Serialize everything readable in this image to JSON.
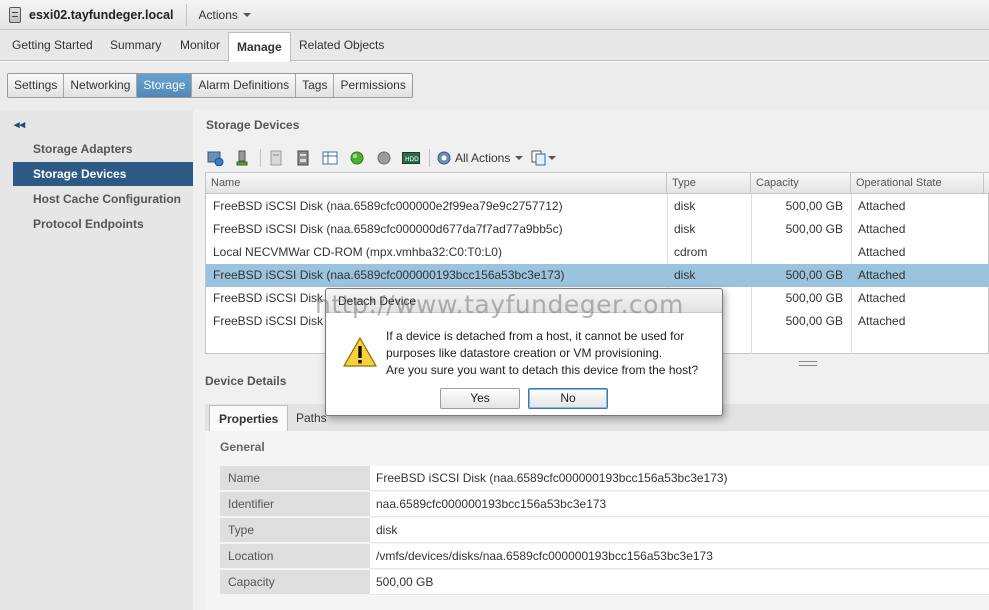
{
  "titlebar": {
    "host": "esxi02.tayfundeger.local",
    "actions_label": "Actions"
  },
  "main_tabs": [
    "Getting Started",
    "Summary",
    "Monitor",
    "Manage",
    "Related Objects"
  ],
  "sub_tabs": [
    "Settings",
    "Networking",
    "Storage",
    "Alarm Definitions",
    "Tags",
    "Permissions"
  ],
  "left_nav": [
    "Storage Adapters",
    "Storage Devices",
    "Host Cache Configuration",
    "Protocol Endpoints"
  ],
  "storage_devices": {
    "title": "Storage Devices",
    "all_actions_label": "All Actions",
    "columns": [
      "Name",
      "Type",
      "Capacity",
      "Operational State"
    ],
    "rows": [
      {
        "name": "FreeBSD iSCSI Disk (naa.6589cfc000000e2f99ea79e9c2757712)",
        "type": "disk",
        "capacity": "500,00 GB",
        "state": "Attached"
      },
      {
        "name": "FreeBSD iSCSI Disk (naa.6589cfc000000d677da7f7ad77a9bb5c)",
        "type": "disk",
        "capacity": "500,00 GB",
        "state": "Attached"
      },
      {
        "name": "Local NECVMWar CD-ROM (mpx.vmhba32:C0:T0:L0)",
        "type": "cdrom",
        "capacity": "",
        "state": "Attached"
      },
      {
        "name": "FreeBSD iSCSI Disk (naa.6589cfc000000193bcc156a53bc3e173)",
        "type": "disk",
        "capacity": "500,00 GB",
        "state": "Attached"
      },
      {
        "name": "FreeBSD iSCSI Disk",
        "type": "",
        "capacity": "500,00 GB",
        "state": "Attached"
      },
      {
        "name": "FreeBSD iSCSI Disk",
        "type": "",
        "capacity": "500,00 GB",
        "state": "Attached"
      }
    ]
  },
  "device_details": {
    "title": "Device Details",
    "tabs": [
      "Properties",
      "Paths"
    ],
    "section": "General",
    "properties": [
      {
        "key": "Name",
        "value": "FreeBSD iSCSI Disk (naa.6589cfc000000193bcc156a53bc3e173)"
      },
      {
        "key": "Identifier",
        "value": "naa.6589cfc000000193bcc156a53bc3e173"
      },
      {
        "key": "Type",
        "value": "disk"
      },
      {
        "key": "Location",
        "value": "/vmfs/devices/disks/naa.6589cfc000000193bcc156a53bc3e173"
      },
      {
        "key": "Capacity",
        "value": "500,00 GB"
      }
    ]
  },
  "dialog": {
    "title": "Detach Device",
    "line1": "If a device is detached from a host, it cannot be used for",
    "line2": "purposes like datastore creation or VM provisioning.",
    "line3": "Are you sure you want to detach this device from the host?",
    "yes_label": "Yes",
    "no_label": "No"
  },
  "watermark": "http://www.tayfundeger.com",
  "colors": {
    "selected_nav": "#2c5a84",
    "selected_row": "#9cc3dd",
    "active_subtab": "#5a92c2"
  }
}
